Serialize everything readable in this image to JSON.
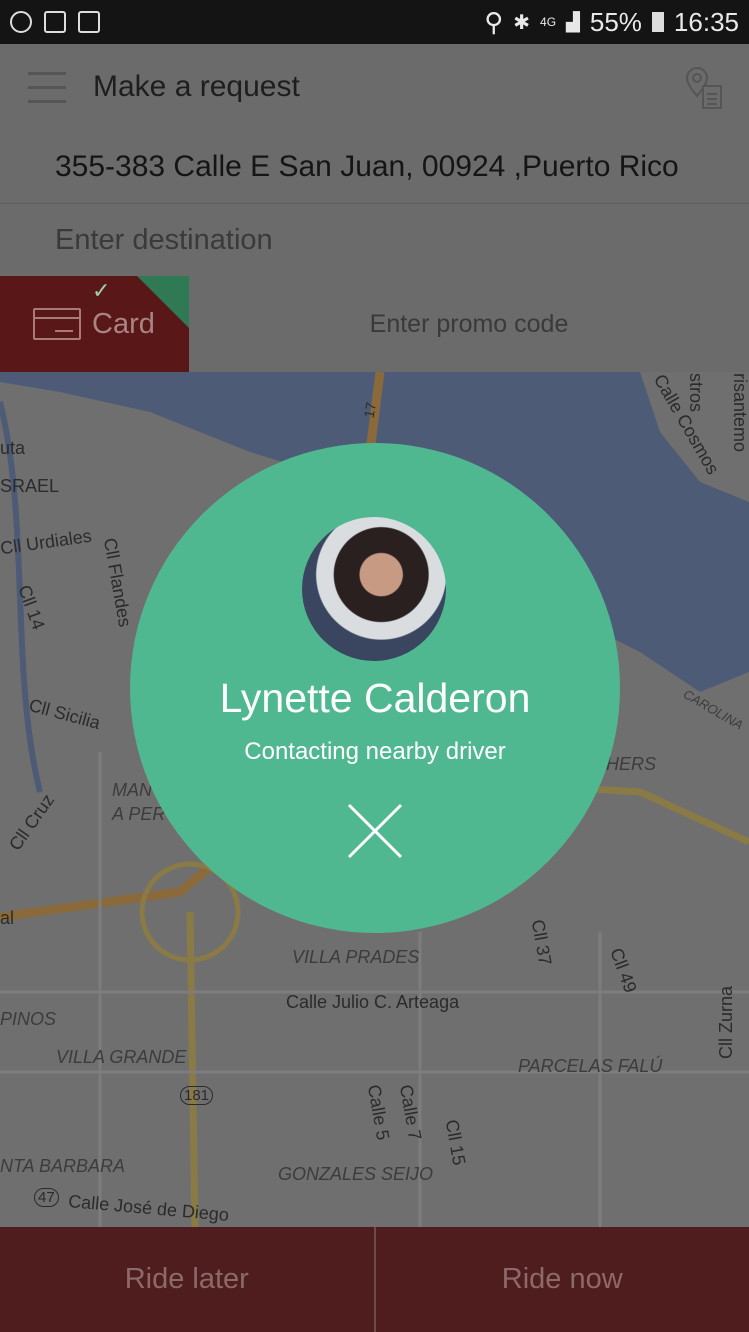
{
  "status_bar": {
    "battery": "55%",
    "time": "16:35",
    "network": "4G"
  },
  "header": {
    "title": "Make a request"
  },
  "pickup": {
    "address": "355-383 Calle E San Juan, 00924 ,Puerto Rico"
  },
  "destination": {
    "placeholder": "Enter destination"
  },
  "payment": {
    "method": "Card",
    "promo_placeholder": "Enter promo code"
  },
  "map": {
    "labels": [
      "uta",
      "SRAEL",
      "Cll Urdiales",
      "Cll Flandes",
      "Cll 14",
      "Cll Sicilia",
      "Cll Cruz",
      "MAN",
      "A PER",
      "al",
      "VILLA PRADES",
      "Calle Julio C. Arteaga",
      "PINOS",
      "VILLA GRANDE",
      "181",
      "NTA BARBARA",
      "47",
      "Calle José de Diego",
      "GONZALES SEIJO",
      "Calle 5",
      "Calle 7",
      "Cll 15",
      "Cll 37",
      "Cll 49",
      "Cll Zurna",
      "PARCELAS FALÚ",
      "17",
      "Calle Cosmos",
      "stros",
      "risantemo",
      "CAROLINA",
      "HERS"
    ]
  },
  "driver": {
    "name": "Lynette Calderon",
    "status": "Contacting nearby driver"
  },
  "actions": {
    "ride_later": "Ride later",
    "ride_now": "Ride now"
  },
  "colors": {
    "accent": "#50b891",
    "card": "#5a1717",
    "buttons": "#4f1d1d"
  }
}
